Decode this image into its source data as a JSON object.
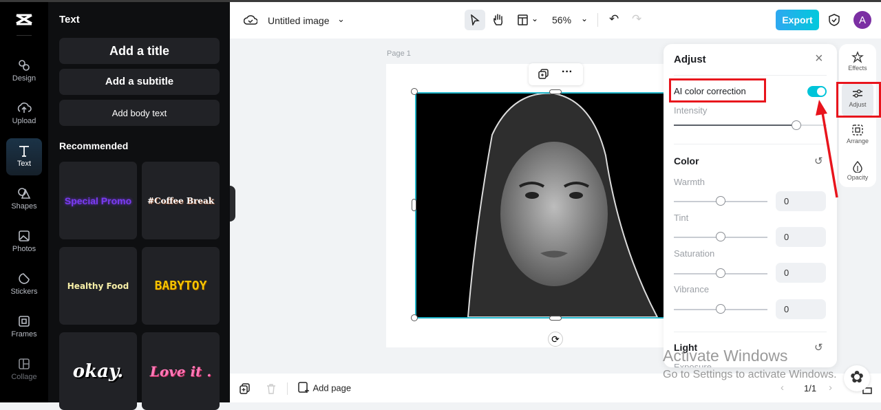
{
  "colors": {
    "accent": "#00c4d9",
    "highlight": "#e8141c",
    "avatar": "#7b2fa3"
  },
  "rail": {
    "items": [
      {
        "label": "Design",
        "icon": "design-icon"
      },
      {
        "label": "Upload",
        "icon": "upload-icon"
      },
      {
        "label": "Text",
        "icon": "text-icon",
        "active": true
      },
      {
        "label": "Shapes",
        "icon": "shapes-icon"
      },
      {
        "label": "Photos",
        "icon": "photos-icon"
      },
      {
        "label": "Stickers",
        "icon": "stickers-icon"
      },
      {
        "label": "Frames",
        "icon": "frames-icon"
      },
      {
        "label": "Collage",
        "icon": "collage-icon"
      }
    ]
  },
  "panel": {
    "title": "Text",
    "add_title": "Add a title",
    "add_subtitle": "Add a subtitle",
    "add_body": "Add body text",
    "recommended": "Recommended",
    "tiles": [
      "Special Promo",
      "#Coffee Break",
      "Healthy Food",
      "BABYTOY",
      "okay.",
      "Love it ."
    ]
  },
  "topbar": {
    "doc_title": "Untitled image",
    "zoom": "56%",
    "export": "Export",
    "avatar": "A"
  },
  "canvas": {
    "page_label": "Page 1"
  },
  "adjust": {
    "title": "Adjust",
    "ai_label": "AI color correction",
    "ai_enabled": true,
    "intensity_label": "Intensity",
    "intensity": 0.8,
    "color_title": "Color",
    "sliders": [
      {
        "label": "Warmth",
        "value": "0"
      },
      {
        "label": "Tint",
        "value": "0"
      },
      {
        "label": "Saturation",
        "value": "0"
      },
      {
        "label": "Vibrance",
        "value": "0"
      }
    ],
    "light_title": "Light",
    "exposure_label": "Exposure"
  },
  "right_rail": [
    "Effects",
    "Adjust",
    "Arrange",
    "Opacity"
  ],
  "bottombar": {
    "add_page": "Add page",
    "pager": "1/1"
  },
  "watermark": {
    "line1": "Activate Windows",
    "line2": "Go to Settings to activate Windows."
  }
}
